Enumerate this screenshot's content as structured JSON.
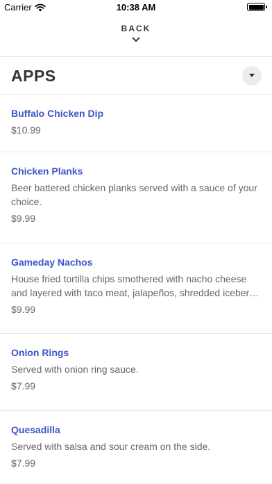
{
  "status_bar": {
    "carrier": "Carrier",
    "time": "10:38 AM"
  },
  "header": {
    "back_label": "BACK"
  },
  "category": {
    "title": "APPS"
  },
  "items": [
    {
      "name": "Buffalo Chicken Dip",
      "description": "",
      "price": "$10.99"
    },
    {
      "name": "Chicken Planks",
      "description": "Beer battered chicken planks served with a sauce of your choice.",
      "price": "$9.99"
    },
    {
      "name": "Gameday Nachos",
      "description": "House fried tortilla chips smothered with nacho cheese and layered with taco meat, jalapeños, shredded iceberg, tomatoes and sour cream.",
      "price": "$9.99"
    },
    {
      "name": "Onion Rings",
      "description": "Served with onion ring sauce.",
      "price": "$7.99"
    },
    {
      "name": "Quesadilla",
      "description": "Served with salsa and sour cream on the side.",
      "price": "$7.99"
    }
  ]
}
